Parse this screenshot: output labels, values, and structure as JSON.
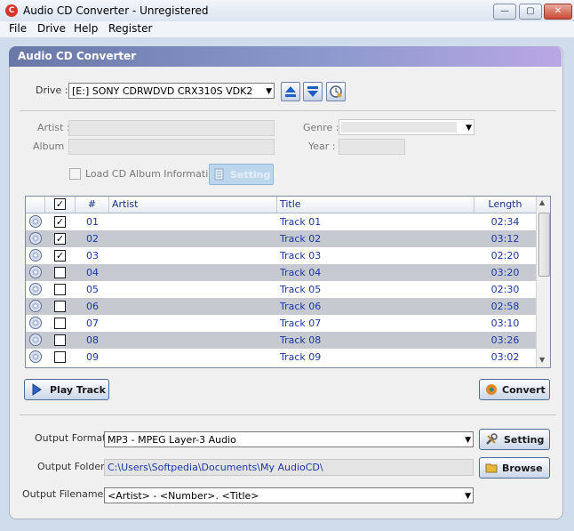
{
  "window": {
    "title": "Audio CD Converter - Unregistered",
    "minimize": "—",
    "maximize": "▢",
    "close": "✕",
    "icon_glyph": "C"
  },
  "menu": [
    "File",
    "Drive",
    "Help",
    "Register"
  ],
  "panel": {
    "title": "Audio CD Converter"
  },
  "drive": {
    "label": "Drive :",
    "value": "[E:] SONY    CDRWDVD CRX310S  VDK2"
  },
  "album": {
    "artist_label": "Artist :",
    "album_label": "Album :",
    "genre_label": "Genre :",
    "year_label": "Year :",
    "load_info_label": "Load CD Album Information",
    "setting_label": "Setting"
  },
  "table": {
    "headers": {
      "num": "#",
      "artist": "Artist",
      "title": "Title",
      "length": "Length"
    },
    "rows": [
      {
        "num": "01",
        "artist": "",
        "title": "Track 01",
        "length": "02:34",
        "checked": true
      },
      {
        "num": "02",
        "artist": "",
        "title": "Track 02",
        "length": "03:12",
        "checked": true
      },
      {
        "num": "03",
        "artist": "",
        "title": "Track 03",
        "length": "02:20",
        "checked": true
      },
      {
        "num": "04",
        "artist": "",
        "title": "Track 04",
        "length": "03:20",
        "checked": false
      },
      {
        "num": "05",
        "artist": "",
        "title": "Track 05",
        "length": "02:30",
        "checked": false
      },
      {
        "num": "06",
        "artist": "",
        "title": "Track 06",
        "length": "02:58",
        "checked": false
      },
      {
        "num": "07",
        "artist": "",
        "title": "Track 07",
        "length": "03:10",
        "checked": false
      },
      {
        "num": "08",
        "artist": "",
        "title": "Track 08",
        "length": "03:26",
        "checked": false
      },
      {
        "num": "09",
        "artist": "",
        "title": "Track 09",
        "length": "03:02",
        "checked": false
      }
    ]
  },
  "buttons": {
    "play": "Play Track",
    "convert": "Convert",
    "setting": "Setting",
    "browse": "Browse"
  },
  "output": {
    "format_label": "Output Format :",
    "format_value": "MP3 - MPEG Layer-3 Audio",
    "folder_label": "Output Folder :",
    "folder_value": "C:\\Users\\Softpedia\\Documents\\My AudioCD\\",
    "filenames_label": "Output Filenames :",
    "filenames_value": "<Artist> - <Number>. <Title>"
  }
}
